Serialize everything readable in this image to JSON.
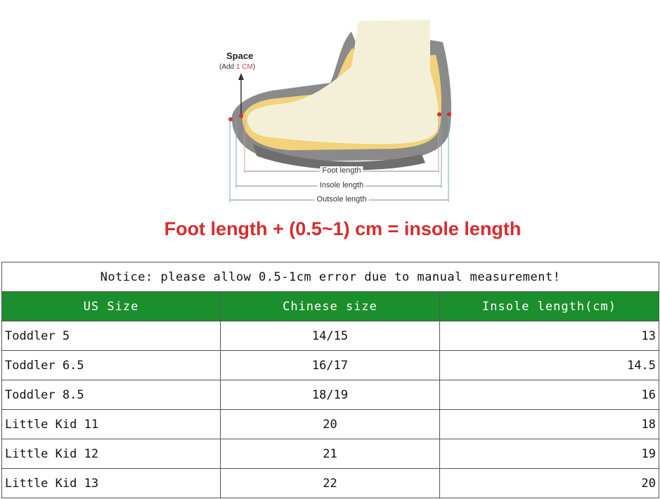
{
  "diagram": {
    "space_label": "Space",
    "add_prefix": "(Add ",
    "add_value": "1 CM",
    "add_suffix": ")",
    "foot_length_label": "Foot length",
    "insole_length_label": "Insole length",
    "outsole_length_label": "Outsole length",
    "headline": "Foot length + (0.5~1) cm = insole length"
  },
  "table": {
    "notice": "Notice: please allow 0.5-1cm error due to manual measurement!",
    "headers": [
      "US Size",
      "Chinese size",
      "Insole length(cm)"
    ],
    "rows": [
      {
        "us": "Toddler 5",
        "cn": "14/15",
        "insole": "13"
      },
      {
        "us": "Toddler 6.5",
        "cn": "16/17",
        "insole": "14.5"
      },
      {
        "us": "Toddler 8.5",
        "cn": "18/19",
        "insole": "16"
      },
      {
        "us": "Little Kid 11",
        "cn": "20",
        "insole": "18"
      },
      {
        "us": "Little Kid 12",
        "cn": "21",
        "insole": "19"
      },
      {
        "us": "Little Kid 13",
        "cn": "22",
        "insole": "20"
      }
    ]
  },
  "colors": {
    "header_green": "#1b8f2d",
    "headline_red": "#d92b2b",
    "foot": "#f4f0d8",
    "shoe_gray": "#8a8a8a",
    "insole_yellow": "#f2d27a"
  }
}
